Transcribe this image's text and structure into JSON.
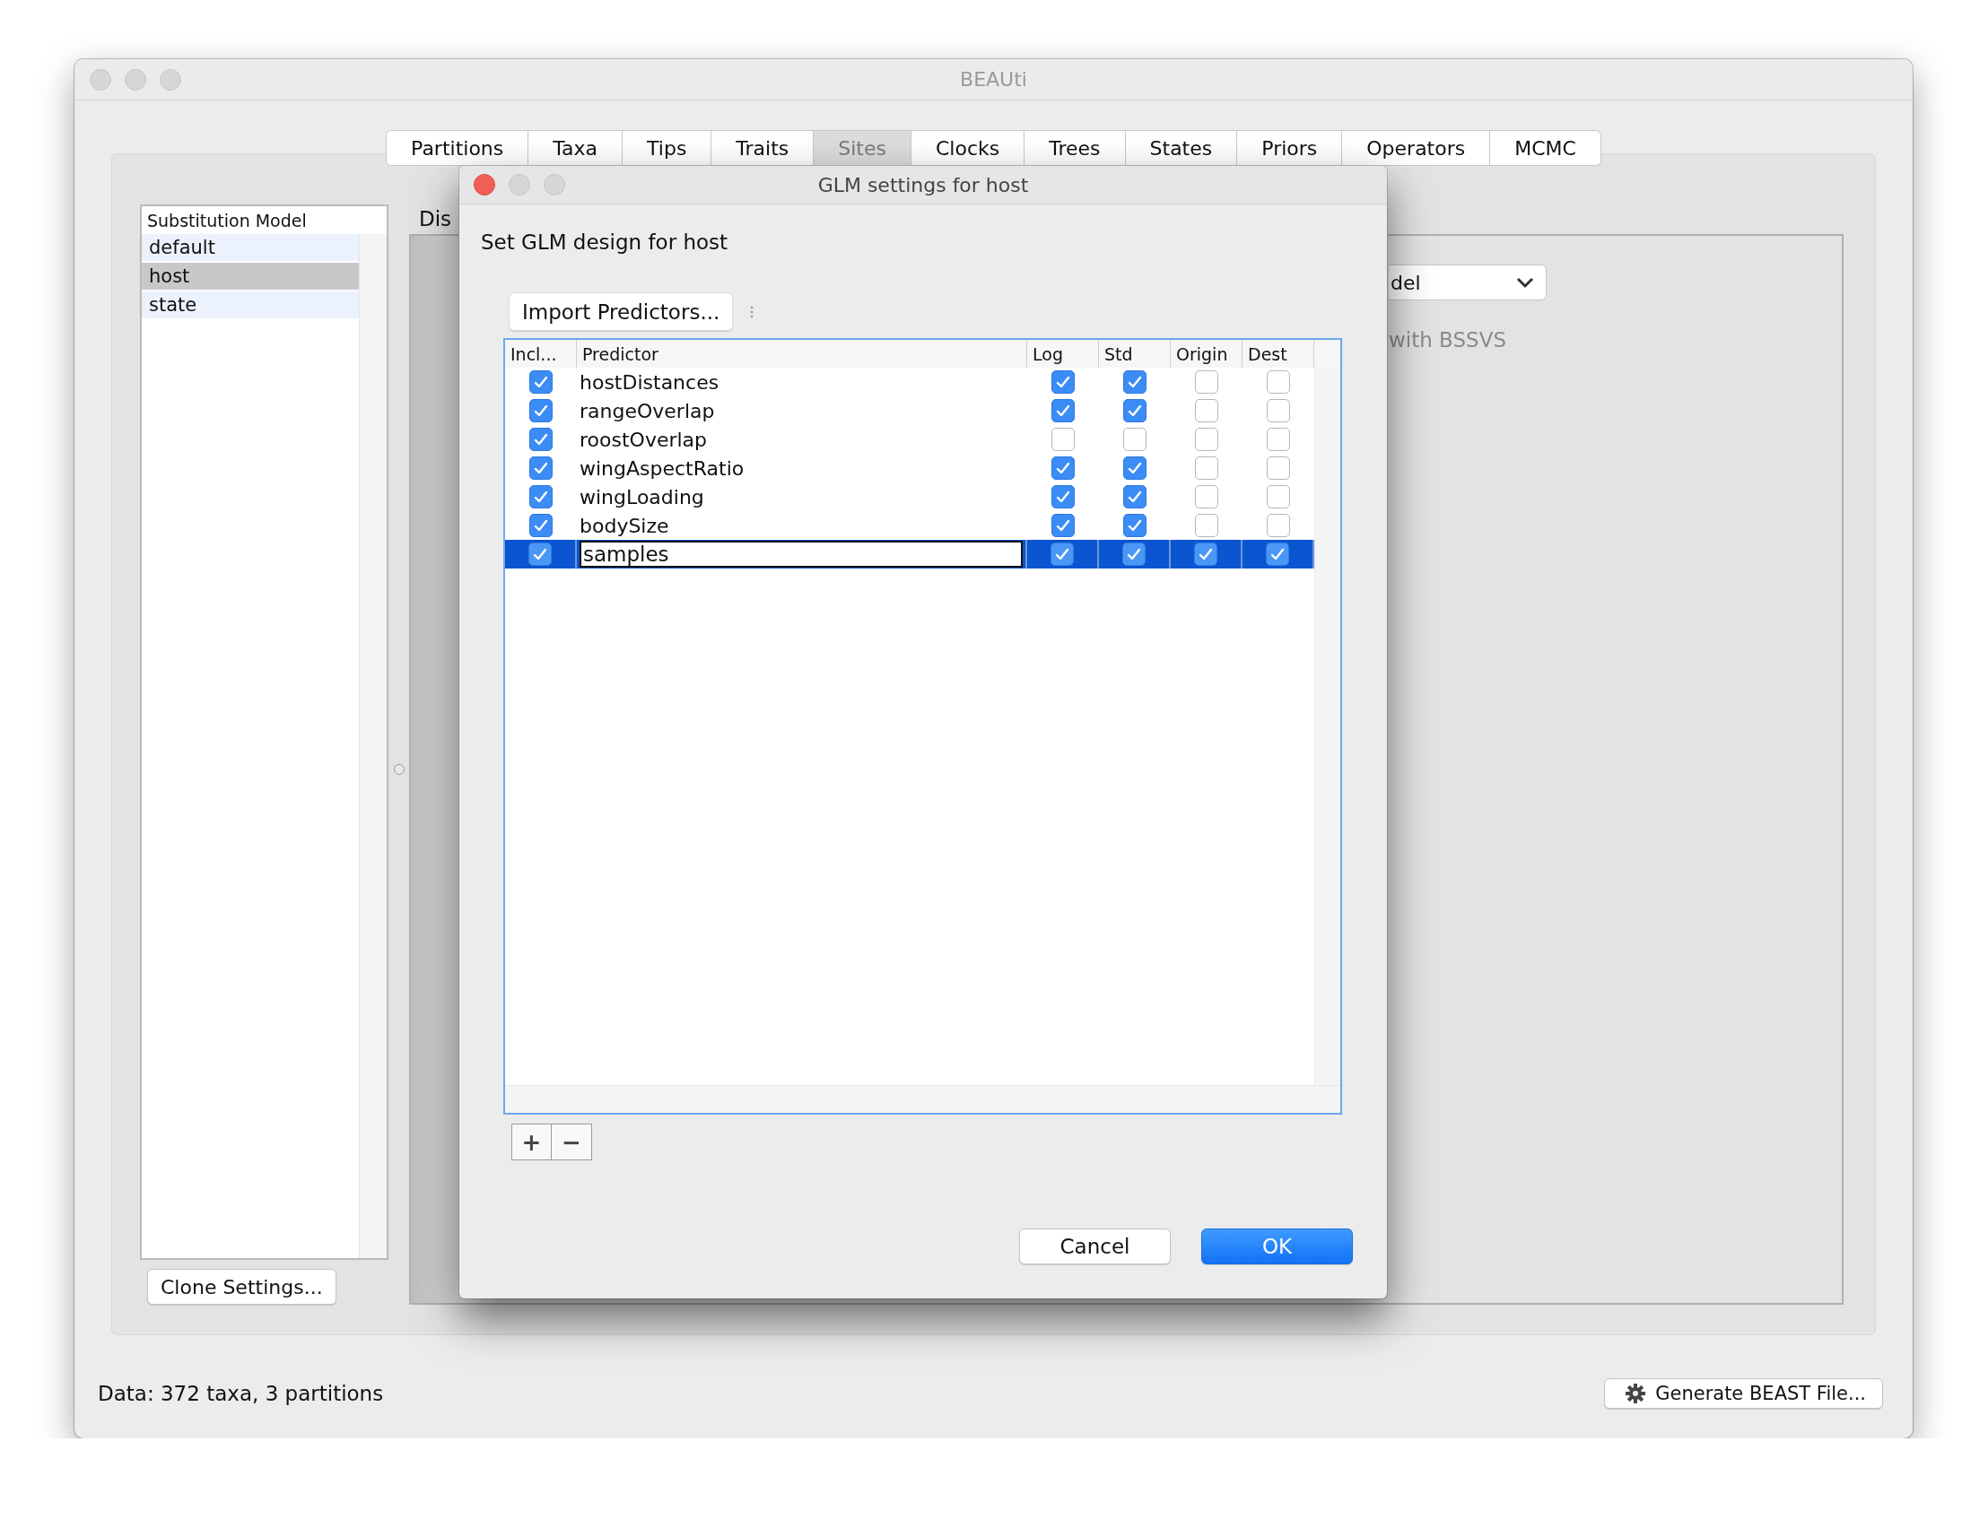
{
  "window": {
    "title": "BEAUti"
  },
  "tabs": [
    {
      "label": "Partitions",
      "selected": false
    },
    {
      "label": "Taxa",
      "selected": false
    },
    {
      "label": "Tips",
      "selected": false
    },
    {
      "label": "Traits",
      "selected": false
    },
    {
      "label": "Sites",
      "selected": true
    },
    {
      "label": "Clocks",
      "selected": false
    },
    {
      "label": "Trees",
      "selected": false
    },
    {
      "label": "States",
      "selected": false
    },
    {
      "label": "Priors",
      "selected": false
    },
    {
      "label": "Operators",
      "selected": false
    },
    {
      "label": "MCMC",
      "selected": false
    }
  ],
  "sidebar": {
    "header": "Substitution Model",
    "items": [
      {
        "label": "default",
        "selected": false
      },
      {
        "label": "host",
        "selected": true
      },
      {
        "label": "state",
        "selected": false
      }
    ],
    "button": "Clone Settings..."
  },
  "panel": {
    "title": "Dis",
    "dropdown": "del",
    "option_label": "with BSSVS"
  },
  "dialog": {
    "title": "GLM settings for host",
    "heading": "Set GLM design for host",
    "import_button": "Import Predictors...",
    "table": {
      "columns": [
        "Incl...",
        "Predictor",
        "Log",
        "Std",
        "Origin",
        "Dest"
      ],
      "rows": [
        {
          "included": true,
          "predictor": "hostDistances",
          "log": true,
          "std": true,
          "origin": false,
          "dest": false,
          "selected": false
        },
        {
          "included": true,
          "predictor": "rangeOverlap",
          "log": true,
          "std": true,
          "origin": false,
          "dest": false,
          "selected": false
        },
        {
          "included": true,
          "predictor": "roostOverlap",
          "log": false,
          "std": false,
          "origin": false,
          "dest": false,
          "selected": false
        },
        {
          "included": true,
          "predictor": "wingAspectRatio",
          "log": true,
          "std": true,
          "origin": false,
          "dest": false,
          "selected": false
        },
        {
          "included": true,
          "predictor": "wingLoading",
          "log": true,
          "std": true,
          "origin": false,
          "dest": false,
          "selected": false
        },
        {
          "included": true,
          "predictor": "bodySize",
          "log": true,
          "std": true,
          "origin": false,
          "dest": false,
          "selected": false
        },
        {
          "included": true,
          "predictor": "samples",
          "log": true,
          "std": true,
          "origin": true,
          "dest": true,
          "selected": true
        }
      ]
    },
    "add_button": "+",
    "remove_button": "−",
    "buttons": [
      {
        "label": "Cancel",
        "default": false
      },
      {
        "label": "OK",
        "default": true
      }
    ]
  },
  "status_bar": {
    "text": "Data: 372 taxa, 3 partitions",
    "button": "Generate BEAST File..."
  }
}
